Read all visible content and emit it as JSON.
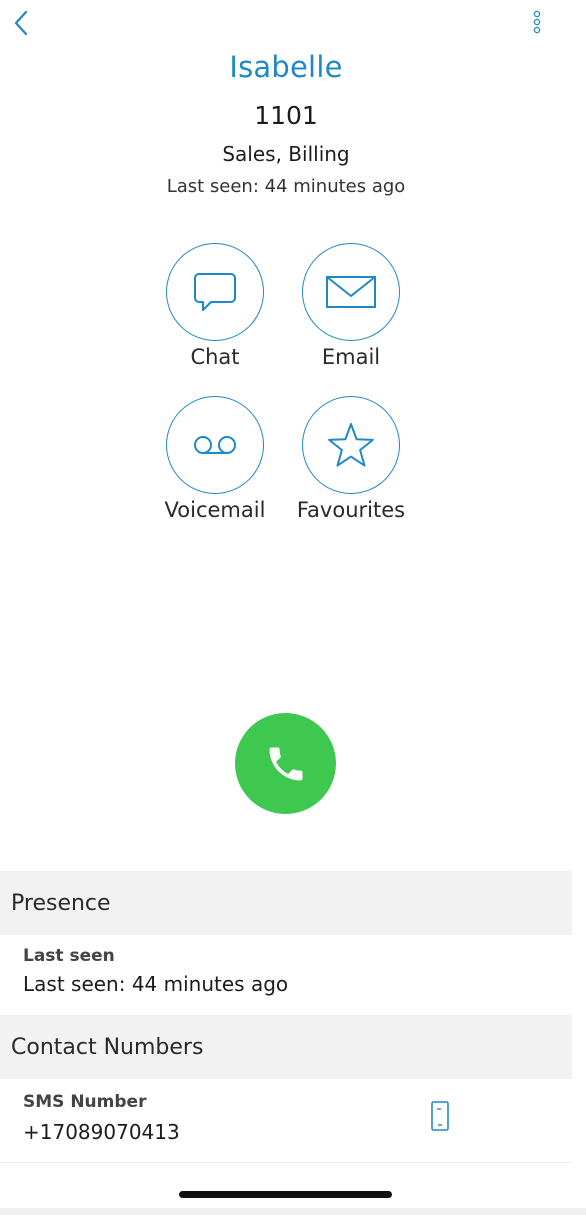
{
  "contact": {
    "name": "Isabelle",
    "extension": "1101",
    "groups": "Sales, Billing",
    "last_seen": "Last seen: 44 minutes ago"
  },
  "actions": [
    {
      "label": "Chat",
      "icon": "chat-bubble-icon"
    },
    {
      "label": "Email",
      "icon": "envelope-icon"
    },
    {
      "label": "Voicemail",
      "icon": "voicemail-icon"
    },
    {
      "label": "Favourites",
      "icon": "star-icon"
    }
  ],
  "call": {
    "icon": "phone-icon",
    "color": "#3ec84f"
  },
  "presence": {
    "header": "Presence",
    "label": "Last seen",
    "value": "Last seen: 44 minutes ago"
  },
  "contact_numbers": {
    "header": "Contact Numbers",
    "items": [
      {
        "label": "SMS Number",
        "value": "+17089070413",
        "icon": "mobile-phone-icon"
      }
    ]
  },
  "colors": {
    "accent": "#1f88c6",
    "call_green": "#3ec84f",
    "section_bg": "#f2f2f2"
  }
}
